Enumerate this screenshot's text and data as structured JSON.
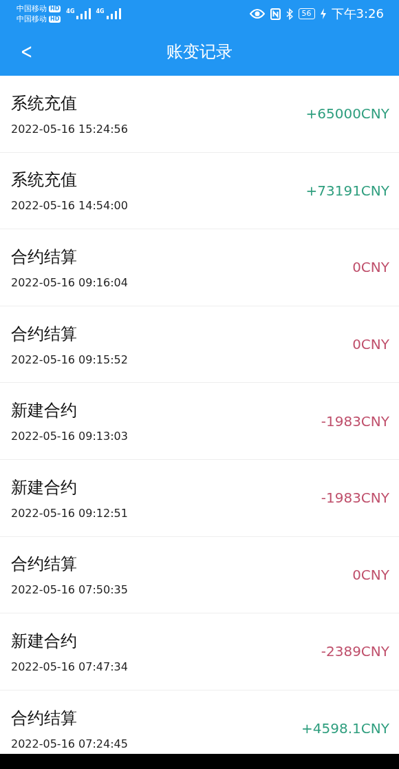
{
  "status_bar": {
    "carriers": [
      {
        "name": "中国移动",
        "badge": "HD",
        "network": "4G"
      },
      {
        "name": "中国移动",
        "badge": "HD",
        "network": "4G"
      }
    ],
    "battery": "56",
    "time": "下午3:26"
  },
  "header": {
    "back": "<",
    "title": "账变记录"
  },
  "records": [
    {
      "title": "系统充值",
      "time": "2022-05-16 15:24:56",
      "amount": "+65000CNY",
      "color": "#2e9e7e"
    },
    {
      "title": "系统充值",
      "time": "2022-05-16 14:54:00",
      "amount": "+73191CNY",
      "color": "#2e9e7e"
    },
    {
      "title": "合约结算",
      "time": "2022-05-16 09:16:04",
      "amount": "0CNY",
      "color": "#bf4f6b"
    },
    {
      "title": "合约结算",
      "time": "2022-05-16 09:15:52",
      "amount": "0CNY",
      "color": "#bf4f6b"
    },
    {
      "title": "新建合约",
      "time": "2022-05-16 09:13:03",
      "amount": "-1983CNY",
      "color": "#bf4f6b"
    },
    {
      "title": "新建合约",
      "time": "2022-05-16 09:12:51",
      "amount": "-1983CNY",
      "color": "#bf4f6b"
    },
    {
      "title": "合约结算",
      "time": "2022-05-16 07:50:35",
      "amount": "0CNY",
      "color": "#bf4f6b"
    },
    {
      "title": "新建合约",
      "time": "2022-05-16 07:47:34",
      "amount": "-2389CNY",
      "color": "#bf4f6b"
    },
    {
      "title": "合约结算",
      "time": "2022-05-16 07:24:45",
      "amount": "+4598.1CNY",
      "color": "#2e9e7e"
    }
  ]
}
